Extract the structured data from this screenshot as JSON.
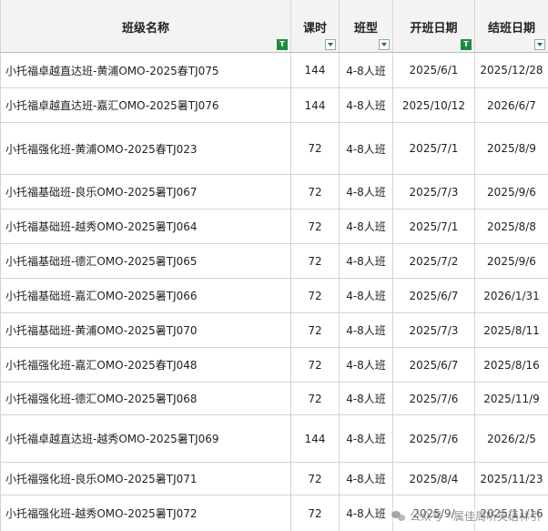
{
  "headers": [
    {
      "label": "班级名称",
      "filter": "active"
    },
    {
      "label": "课时",
      "filter": "dropdown"
    },
    {
      "label": "班型",
      "filter": "dropdown"
    },
    {
      "label": "开班日期",
      "filter": "active"
    },
    {
      "label": "结班日期",
      "filter": "dropdown"
    }
  ],
  "rows": [
    [
      "小托福卓越直达班-黄浦OMO-2025春TJ075",
      "144",
      "4-8人班",
      "2025/6/1",
      "2025/12/28"
    ],
    [
      "小托福卓越直达班-嘉汇OMO-2025暑TJ076",
      "144",
      "4-8人班",
      "2025/10/12",
      "2026/6/7"
    ],
    [
      "小托福强化班-黄浦OMO-2025春TJ023",
      "72",
      "4-8人班",
      "2025/7/1",
      "2025/8/9"
    ],
    [
      "小托福基础班-良乐OMO-2025暑TJ067",
      "72",
      "4-8人班",
      "2025/7/3",
      "2025/9/6"
    ],
    [
      "小托福基础班-越秀OMO-2025暑TJ064",
      "72",
      "4-8人班",
      "2025/7/1",
      "2025/8/8"
    ],
    [
      "小托福基础班-德汇OMO-2025暑TJ065",
      "72",
      "4-8人班",
      "2025/7/2",
      "2025/9/6"
    ],
    [
      "小托福基础班-嘉汇OMO-2025暑TJ066",
      "72",
      "4-8人班",
      "2025/6/7",
      "2026/1/31"
    ],
    [
      "小托福基础班-黄浦OMO-2025暑TJ070",
      "72",
      "4-8人班",
      "2025/7/3",
      "2025/8/11"
    ],
    [
      "小托福强化班-嘉汇OMO-2025春TJ048",
      "72",
      "4-8人班",
      "2025/6/7",
      "2025/8/16"
    ],
    [
      "小托福强化班-德汇OMO-2025暑TJ068",
      "72",
      "4-8人班",
      "2025/7/6",
      "2025/11/9"
    ],
    [
      "小托福卓越直达班-越秀OMO-2025暑TJ069",
      "144",
      "4-8人班",
      "2025/7/6",
      "2026/2/5"
    ],
    [
      "小托福强化班-良乐OMO-2025暑TJ071",
      "72",
      "4-8人班",
      "2025/8/4",
      "2025/11/23"
    ],
    [
      "小托福强化班-越秀OMO-2025暑TJ072",
      "72",
      "4-8人班",
      "2025/9/",
      "2025/11/16"
    ]
  ],
  "watermark": {
    "icon": "wechat-icon",
    "text1": "公众号",
    "sep": "·",
    "text2": "属佳周听英语林引"
  }
}
